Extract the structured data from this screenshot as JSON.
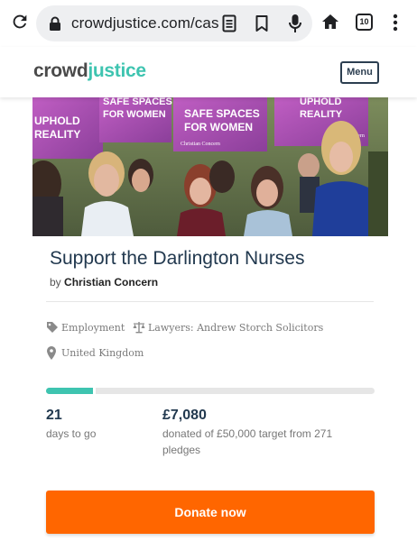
{
  "browser": {
    "url": "crowdjustice.com/cas",
    "tab_count": "10"
  },
  "header": {
    "logo_part1": "crowd",
    "logo_part2": "justice",
    "menu_label": "Menu"
  },
  "hero": {
    "sign_texts": [
      "UPHOLD REALITY",
      "SAFE SPACES FOR WOMEN",
      "SAFE SPACES FOR WOMEN",
      "UPHOLD REALITY"
    ],
    "sign_logo": "Christian Concern"
  },
  "campaign": {
    "title": "Support the Darlington Nurses",
    "by_prefix": "by",
    "organiser": "Christian Concern",
    "category": "Employment",
    "lawyers": "Lawyers: Andrew Storch Solicitors",
    "location": "United Kingdom"
  },
  "stats": {
    "progress_fraction": 0.1416,
    "days_value": "21",
    "days_label": "days to go",
    "amount_value": "£7,080",
    "amount_label": "donated of £50,000 target from 271 pledges"
  },
  "actions": {
    "donate_label": "Donate now"
  },
  "colors": {
    "brand_teal": "#3ec4b0",
    "title_navy": "#22394f",
    "donate_orange": "#ff6600",
    "sign_purple": "#b04fb5"
  },
  "icons": [
    "reload-icon",
    "lock-icon",
    "page-info-icon",
    "bookmark-icon",
    "mic-icon",
    "home-icon",
    "tabs-icon",
    "more-vert-icon",
    "tag-icon",
    "scales-icon",
    "location-pin-icon"
  ]
}
